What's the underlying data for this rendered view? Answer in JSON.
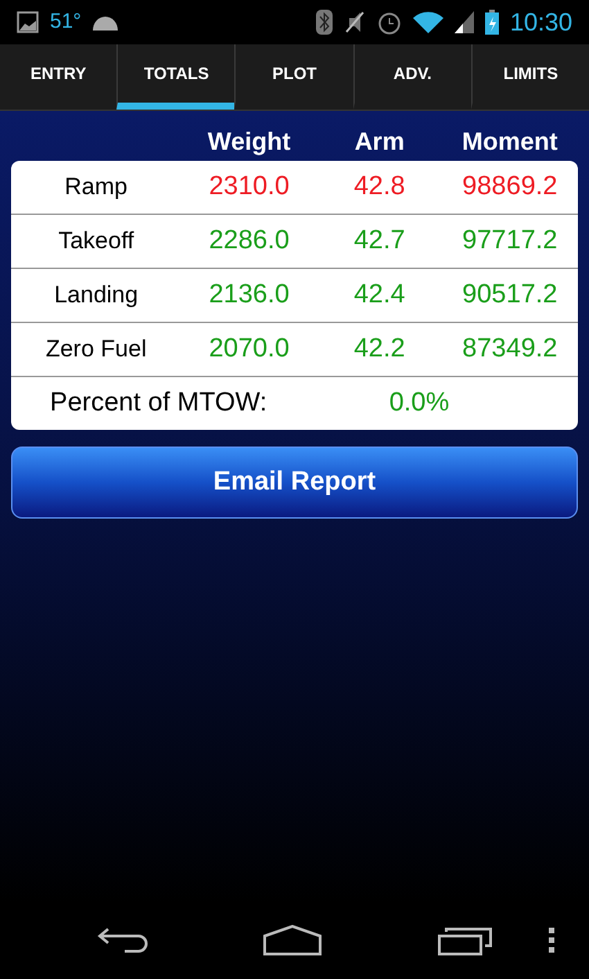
{
  "status_bar": {
    "temperature": "51°",
    "time": "10:30"
  },
  "tabs": [
    {
      "label": "ENTRY",
      "selected": false
    },
    {
      "label": "TOTALS",
      "selected": true
    },
    {
      "label": "PLOT",
      "selected": false
    },
    {
      "label": "ADV.",
      "selected": false
    },
    {
      "label": "LIMITS",
      "selected": false
    }
  ],
  "table": {
    "columns": [
      "Weight",
      "Arm",
      "Moment"
    ],
    "rows": [
      {
        "label": "Ramp",
        "values": [
          "2310.0",
          "42.8",
          "98869.2"
        ],
        "color": "#ee1c24"
      },
      {
        "label": "Takeoff",
        "values": [
          "2286.0",
          "42.7",
          "97717.2"
        ],
        "color": "#1a9e1a"
      },
      {
        "label": "Landing",
        "values": [
          "2136.0",
          "42.4",
          "90517.2"
        ],
        "color": "#1a9e1a"
      },
      {
        "label": "Zero Fuel",
        "values": [
          "2070.0",
          "42.2",
          "87349.2"
        ],
        "color": "#1a9e1a"
      }
    ],
    "percent": {
      "label": "Percent of MTOW:",
      "value": "0.0%",
      "color": "#1a9e1a"
    }
  },
  "email_button": "Email Report"
}
